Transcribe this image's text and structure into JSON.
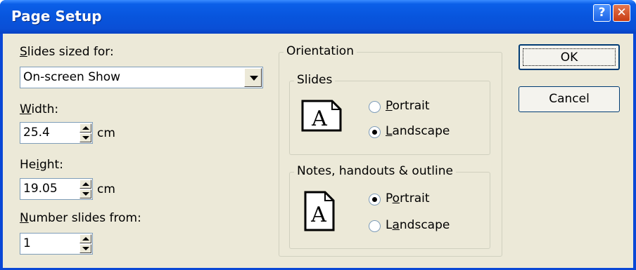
{
  "window": {
    "title": "Page Setup",
    "help_glyph": "?",
    "close_glyph": "✕"
  },
  "slides_sized_for": {
    "label_ul": "S",
    "label_rest": "lides sized for:",
    "value": "On-screen Show"
  },
  "width": {
    "label_ul": "W",
    "label_rest": "idth:",
    "value": "25.4",
    "unit": "cm"
  },
  "height": {
    "label_pre": "He",
    "label_ul": "i",
    "label_rest": "ght:",
    "value": "19.05",
    "unit": "cm"
  },
  "number_from": {
    "label_ul": "N",
    "label_rest": "umber slides from:",
    "value": "1"
  },
  "orientation": {
    "title": "Orientation",
    "slides": {
      "title": "Slides",
      "options": [
        {
          "ul": "P",
          "rest": "ortrait",
          "selected": false
        },
        {
          "ul": "L",
          "rest": "andscape",
          "selected": true
        }
      ]
    },
    "notes": {
      "title": "Notes, handouts & outline",
      "options": [
        {
          "ul": "o",
          "pre": "P",
          "rest": "rtrait",
          "selected": true
        },
        {
          "ul": "a",
          "pre": "L",
          "rest": "ndscape",
          "selected": false
        }
      ]
    },
    "icon_letter": "A"
  },
  "buttons": {
    "ok": "OK",
    "cancel": "Cancel"
  }
}
